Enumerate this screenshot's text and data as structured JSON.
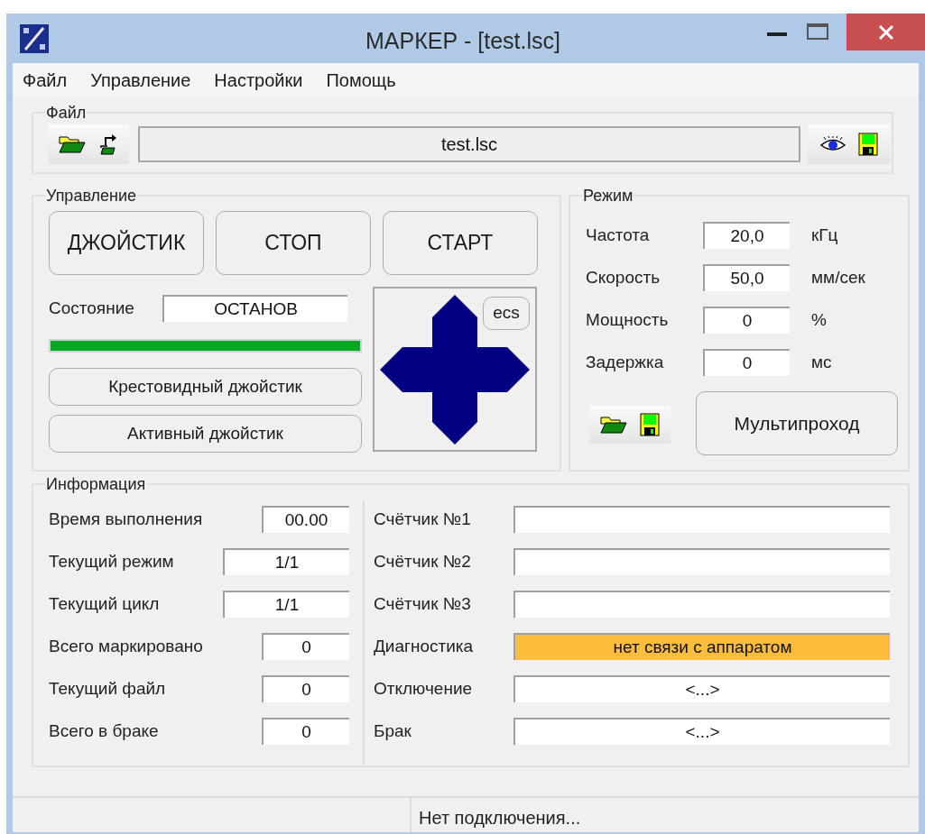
{
  "window": {
    "title": "МАРКЕР - [test.lsc]"
  },
  "menu": [
    "Файл",
    "Управление",
    "Настройки",
    "Помощь"
  ],
  "file_group": {
    "title": "Файл",
    "file_name": "test.lsc"
  },
  "control_group": {
    "title": "Управление",
    "buttons": [
      "ДЖОЙСТИК",
      "СТОП",
      "СТАРТ"
    ],
    "state_label": "Состояние",
    "state_value": "ОСТАНОВ",
    "progress": {
      "level": 1
    },
    "joystick_buttons": [
      "Крестовидный джойстик",
      "Активный джойстик"
    ],
    "esc_button": "ecs"
  },
  "mode_group": {
    "title": "Режим",
    "params": [
      {
        "label": "Частота",
        "value": "20,0",
        "unit": "кГц"
      },
      {
        "label": "Скорость",
        "value": "50,0",
        "unit": "мм/сек"
      },
      {
        "label": "Мощность",
        "value": "0",
        "unit": "%"
      },
      {
        "label": "Задержка",
        "value": "0",
        "unit": "мс"
      }
    ],
    "multipass_button": "Мультипроход"
  },
  "info_group": {
    "title": "Информация",
    "left_rows": [
      {
        "label": "Время выполнения",
        "value": "00.00",
        "kind": "narrow"
      },
      {
        "label": "Текущий режим",
        "value": "1/1",
        "kind": "wide"
      },
      {
        "label": "Текущий цикл",
        "value": "1/1",
        "kind": "wide"
      },
      {
        "label": "Всего маркировано",
        "value": "0",
        "kind": "narrow"
      },
      {
        "label": "Текущий файл",
        "value": "0",
        "kind": "narrow"
      },
      {
        "label": "Всего в браке",
        "value": "0",
        "kind": "narrow"
      }
    ],
    "right_rows": [
      {
        "label": "Счётчик №1",
        "color": "#ffffff"
      },
      {
        "label": "Счётчик №2",
        "color": "#ffffff"
      },
      {
        "label": "Счётчик №3",
        "color": "#ffffff"
      },
      {
        "label": "Диагностика",
        "value": "нет связи с аппаратом",
        "color": "#fdbd3c"
      },
      {
        "label": "Отключение",
        "value": "<...>",
        "color": "#ffffff"
      },
      {
        "label": "Брак",
        "value": "<...>",
        "color": "#ffffff"
      }
    ]
  },
  "status_bar": {
    "text": "Нет подключения..."
  }
}
